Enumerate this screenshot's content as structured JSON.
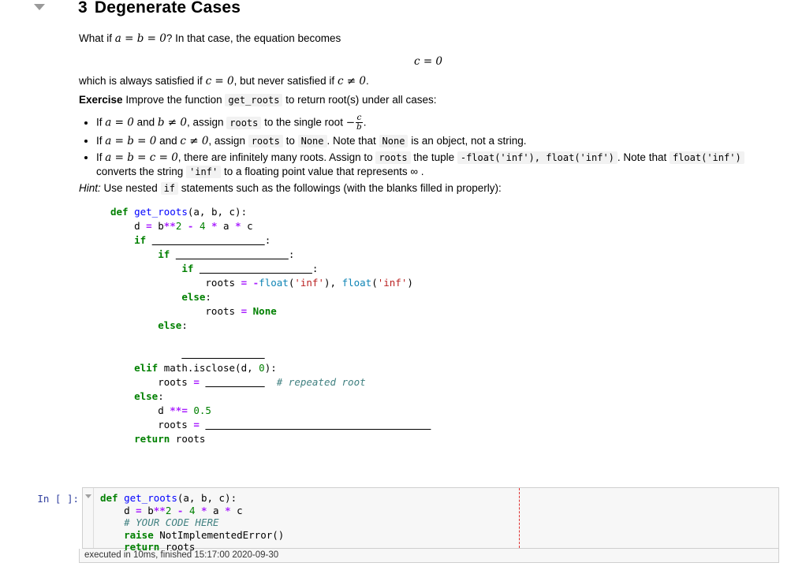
{
  "heading": {
    "section_number": "3",
    "title": "Degenerate Cases",
    "collapse_icon": "triangle-down-icon"
  },
  "markdown": {
    "para_what_if_prefix": "What if ",
    "para_what_if_math": "a = b = 0",
    "para_what_if_suffix": "? In that case, the equation becomes",
    "display_equation": "c = 0",
    "para_which_prefix": "which is always satisfied if ",
    "para_which_math1": "c = 0",
    "para_which_mid": ", but never satisfied if ",
    "para_which_math2": "c ≠ 0",
    "para_which_suffix": ".",
    "exercise_label": "Exercise",
    "exercise_text_before_code": " Improve the function ",
    "exercise_code": "get_roots",
    "exercise_text_after_code": " to return root(s) under all cases:",
    "bullets": [
      {
        "seg1": "If ",
        "math1": "a = 0",
        "seg2": " and ",
        "math2": "b ≠ 0",
        "seg3": ", assign ",
        "code1": "roots",
        "seg4": " to the single root ",
        "frac_sign": "−",
        "frac_num": "c",
        "frac_den": "b",
        "seg5": "."
      },
      {
        "seg1": "If ",
        "math1": "a = b = 0",
        "seg2": " and ",
        "math2": "c ≠ 0",
        "seg3": ", assign ",
        "code1": "roots",
        "seg4": " to ",
        "code2": "None",
        "seg5": ". Note that ",
        "code3": "None",
        "seg6": " is an object, not a string."
      },
      {
        "seg1": "If ",
        "math1": "a = b = c = 0",
        "seg2": ", there are infinitely many roots. Assign to ",
        "code1": "roots",
        "seg3": " the tuple ",
        "code2": "-float('inf'), float('inf')",
        "seg4": ". Note that ",
        "code3": "float('inf')",
        "seg5": " converts the string ",
        "code4": "'inf'",
        "seg6": " to a floating point value that represents ∞ ."
      }
    ],
    "hint_label": "Hint:",
    "hint_before_code": " Use nested ",
    "hint_code": "if",
    "hint_after_code": " statements such as the followings (with the blanks filled in properly):"
  },
  "hint_code_block": {
    "lines": [
      "def get_roots(a, b, c):",
      "    d = b**2 - 4 * a * c",
      "    if ___________________:",
      "        if ___________________:",
      "            if ___________________:",
      "                roots = -float('inf'), float('inf')",
      "            else:",
      "                roots = None",
      "        else:",
      "            ______________",
      "    elif math.isclose(d, 0):",
      "        roots = __________  # repeated root",
      "    else:",
      "        d **= 0.5",
      "        roots = ______________________________________",
      "    return roots"
    ]
  },
  "code_cell": {
    "prompt": "In [ ]:",
    "collapse_icon": "triangle-down-icon",
    "lines": [
      "def get_roots(a, b, c):",
      "    d = b**2 - 4 * a * c",
      "    # YOUR CODE HERE",
      "    raise NotImplementedError()",
      "    return roots"
    ],
    "execution_footer": "executed in 10ms, finished 15:17:00 2020-09-30"
  },
  "colors": {
    "keyword": "#008000",
    "function_name": "#0000ff",
    "operator": "#aa22ff",
    "number": "#008000",
    "string": "#ba2121",
    "builtin": "#0e84b5",
    "comment": "#408080",
    "prompt": "#303f9f",
    "cell_background": "#f7f7f7",
    "cell_border": "#cfcfcf",
    "ruler": "#e03131",
    "inline_code_background": "#f2f2f2"
  }
}
